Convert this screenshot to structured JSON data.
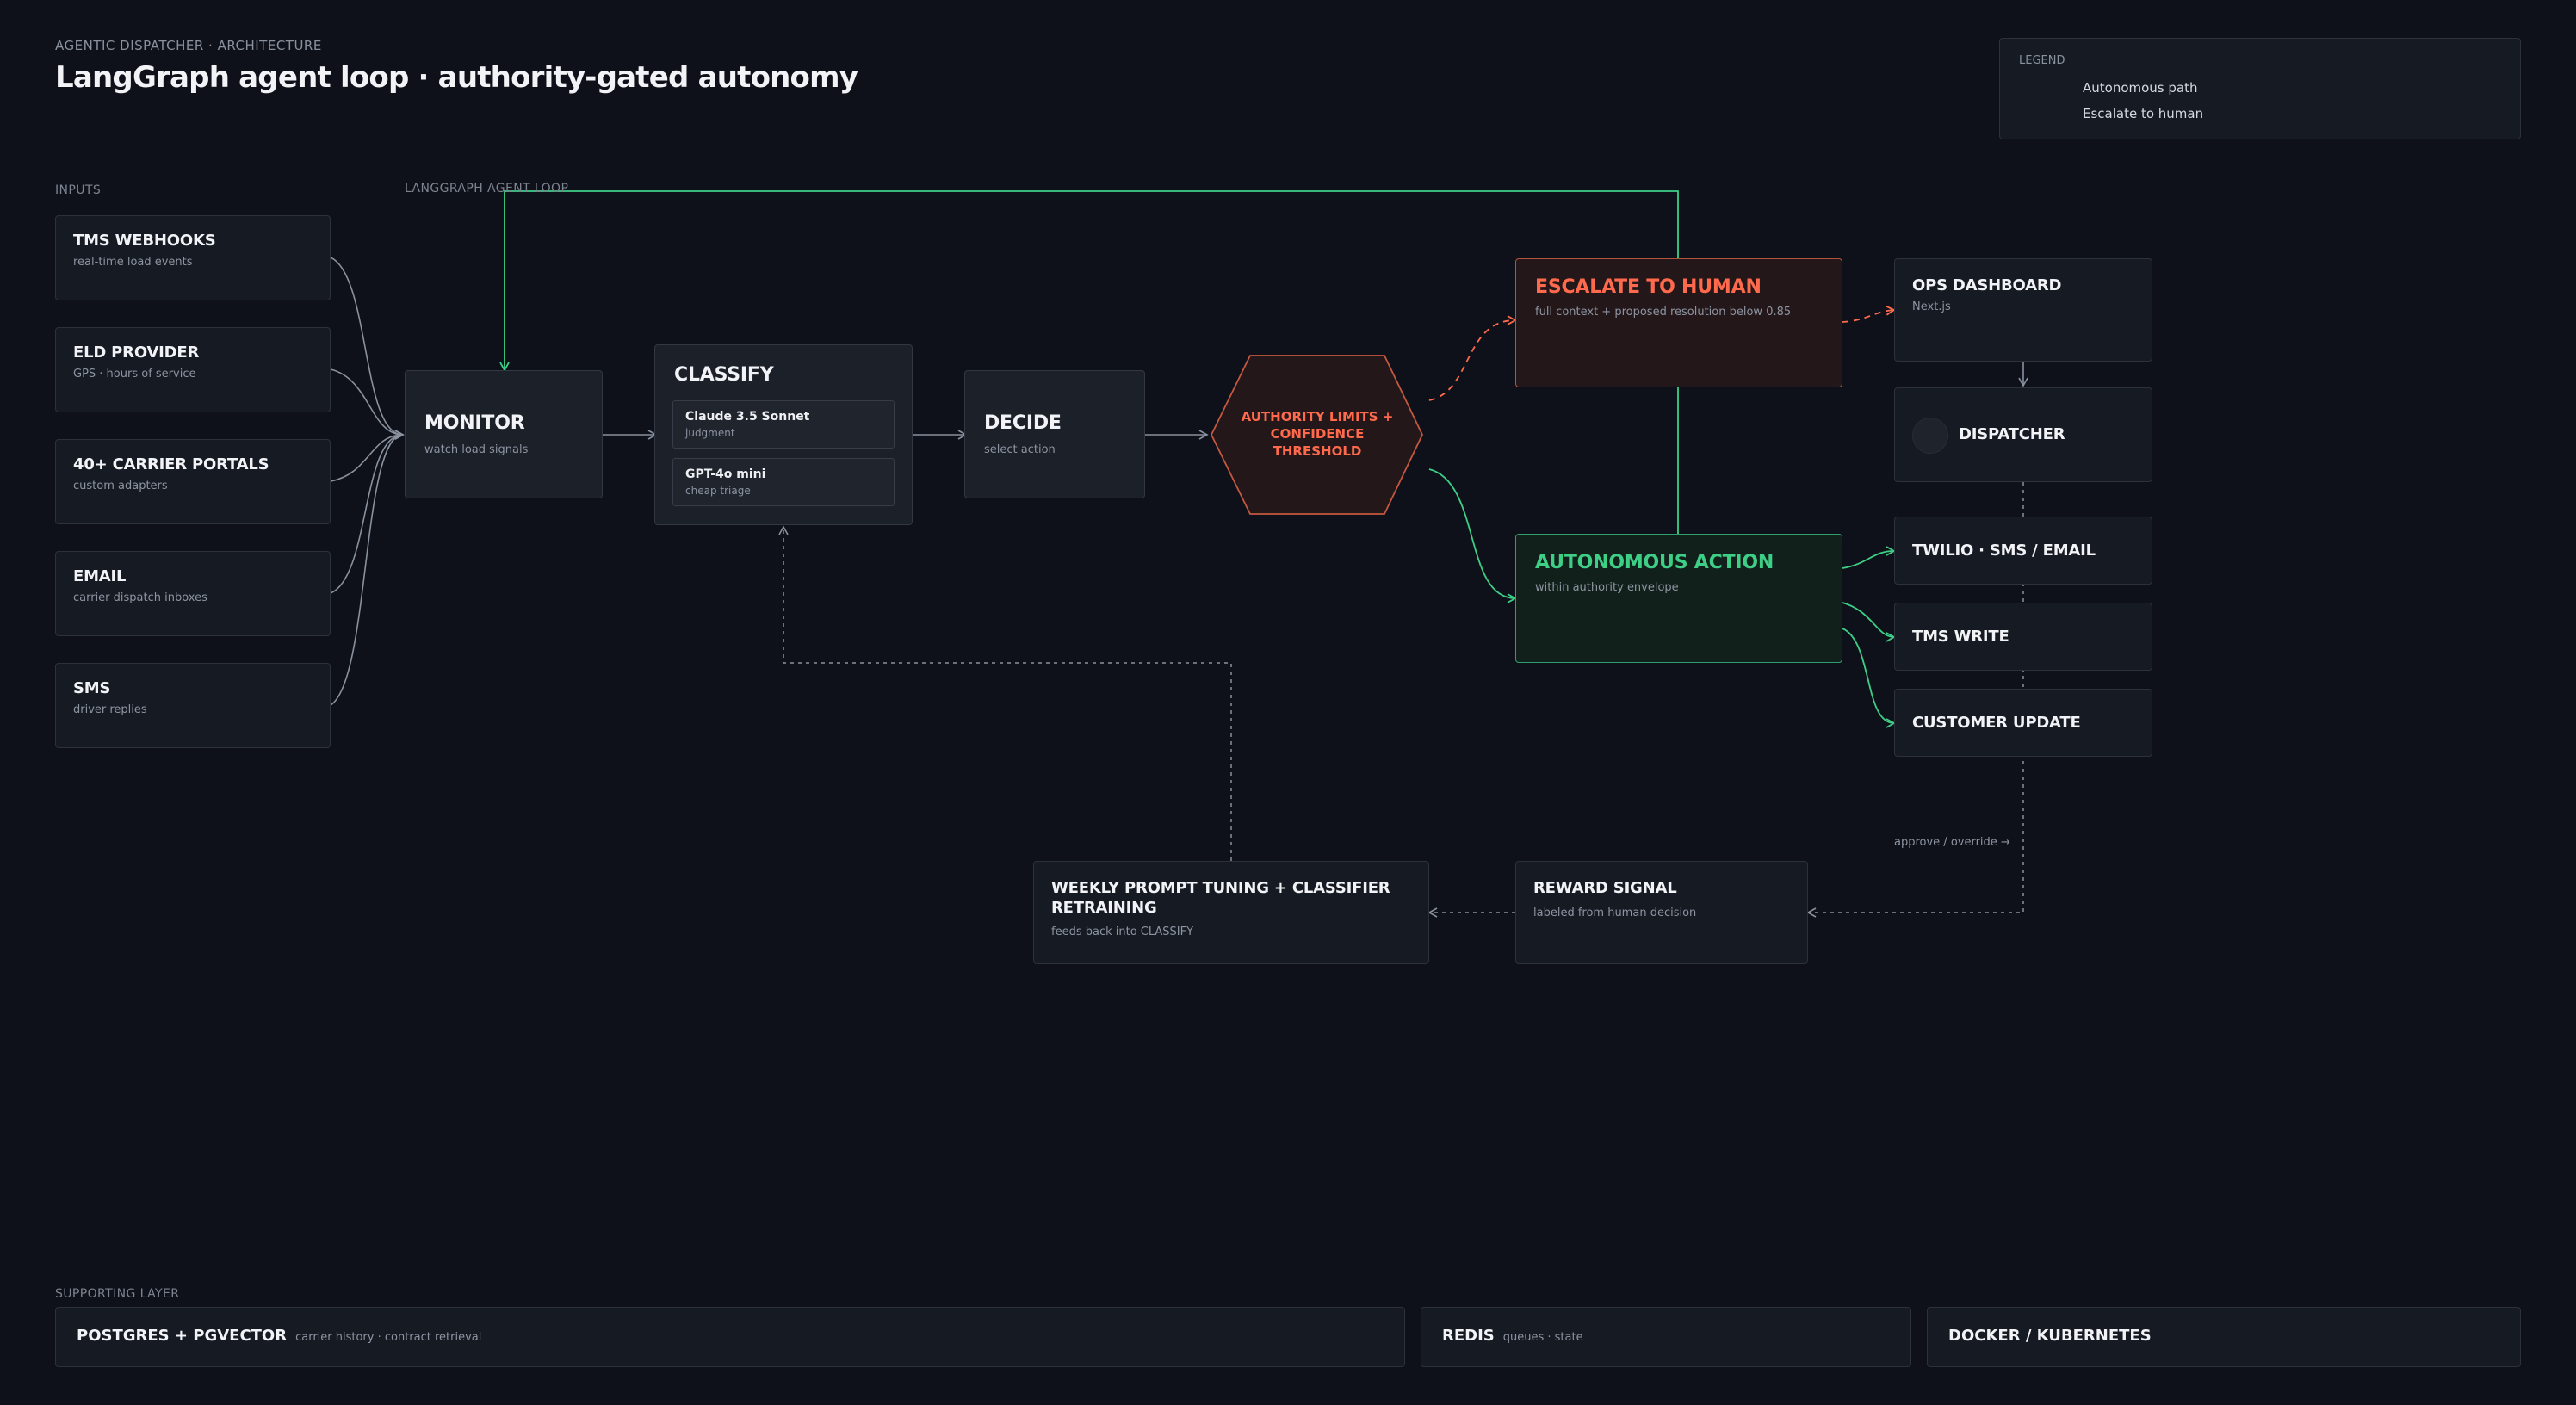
{
  "header": {
    "kicker": "AGENTIC DISPATCHER · ARCHITECTURE",
    "title": "LangGraph agent loop · authority-gated autonomy"
  },
  "legend": {
    "title": "LEGEND",
    "autonomous": "Autonomous path",
    "escalate": "Escalate to human",
    "colors": {
      "autonomous": "#3ecf86",
      "escalate": "#ff6a4d"
    }
  },
  "sections": {
    "inputs": "INPUTS",
    "loop": "LANGGRAPH AGENT LOOP",
    "supporting": "SUPPORTING LAYER"
  },
  "inputs": [
    {
      "title": "TMS WEBHOOKS",
      "sub": "real-time load events"
    },
    {
      "title": "ELD PROVIDER",
      "sub": "GPS · hours of service"
    },
    {
      "title": "40+ CARRIER PORTALS",
      "sub": "custom adapters"
    },
    {
      "title": "EMAIL",
      "sub": "carrier dispatch inboxes"
    },
    {
      "title": "SMS",
      "sub": "driver replies"
    }
  ],
  "monitor": {
    "title": "MONITOR",
    "sub": "watch load signals"
  },
  "classify": {
    "title": "CLASSIFY",
    "models": [
      {
        "title": "Claude 3.5 Sonnet",
        "sub": "judgment"
      },
      {
        "title": "GPT-4o mini",
        "sub": "cheap triage"
      }
    ]
  },
  "decide": {
    "title": "DECIDE",
    "sub": "select action"
  },
  "gate": {
    "line1": "AUTHORITY LIMITS +",
    "line2": "CONFIDENCE",
    "line3": "THRESHOLD"
  },
  "escalate": {
    "title": "ESCALATE TO HUMAN",
    "sub": "full context + proposed resolution below 0.85"
  },
  "autonomous": {
    "title": "AUTONOMOUS ACTION",
    "sub": "within authority envelope"
  },
  "outputs": {
    "ops": {
      "title": "OPS DASHBOARD",
      "sub": "Next.js"
    },
    "dispatcher": {
      "title": "DISPATCHER"
    },
    "twilio": {
      "title": "TWILIO · SMS / EMAIL"
    },
    "tms": {
      "title": "TMS WRITE"
    },
    "customer": {
      "title": "CUSTOMER UPDATE"
    }
  },
  "feedback": {
    "approve_note": "approve / override →",
    "reward": {
      "title": "REWARD SIGNAL",
      "sub": "labeled from human decision"
    },
    "tuning": {
      "title_line1": "WEEKLY PROMPT TUNING + CLASSIFIER",
      "title_line2": "RETRAINING",
      "sub": "feeds back into CLASSIFY"
    }
  },
  "supporting": [
    {
      "title": "POSTGRES + PGVECTOR",
      "sub": "carrier history · contract retrieval"
    },
    {
      "title": "REDIS",
      "sub": "queues · state"
    },
    {
      "title": "DOCKER / KUBERNETES",
      "sub": ""
    }
  ]
}
